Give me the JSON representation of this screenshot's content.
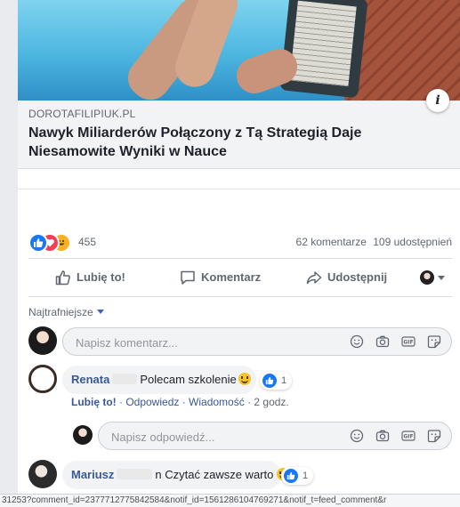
{
  "link_preview": {
    "domain": "DOROTAFILIPIUK.PL",
    "title": "Nawyk Miliarderów Połączony z Tą Strategią Daje Niesamowite Wyniki w Nauce",
    "info_icon": "info-icon"
  },
  "summary": {
    "reaction_icons": [
      "like-reaction-icon",
      "love-reaction-icon",
      "haha-reaction-icon"
    ],
    "reaction_count": "455",
    "comments": "62 komentarze",
    "shares": "109 udostępnień"
  },
  "actions": {
    "like": "Lubię to!",
    "comment": "Komentarz",
    "share": "Udostępnij"
  },
  "sort_label": "Najtrafniejsze",
  "composer": {
    "placeholder": "Napisz komentarz..."
  },
  "comments": [
    {
      "author": "Renata",
      "text": "Polecam szkolenie",
      "likes": "1",
      "actions": {
        "like": "Lubię to!",
        "reply": "Odpowiedz",
        "message": "Wiadomość",
        "time": "2 godz."
      }
    },
    {
      "author": "Mariusz",
      "text": "n Czytać zawsze warto",
      "likes": "1"
    }
  ],
  "reply_composer": {
    "placeholder": "Napisz odpowiedź..."
  },
  "status_url": "31253?comment_id=2377712775842584&notif_id=1561286104769271&notif_t=feed_comment&r",
  "colors": {
    "link_blue": "#385898",
    "like_blue": "#1877f2",
    "love_red": "#f33e58",
    "haha_yellow": "#f7b125"
  }
}
